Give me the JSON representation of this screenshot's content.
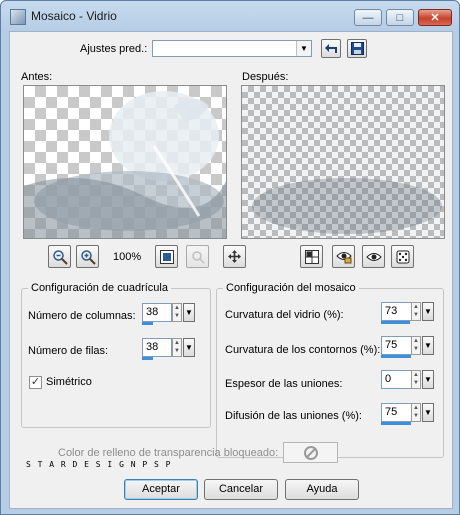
{
  "window": {
    "title": "Mosaico - Vidrio",
    "minimize_glyph": "—",
    "maximize_glyph": "□",
    "close_glyph": "✕"
  },
  "presets": {
    "label": "Ajustes pred.:",
    "value": "",
    "arrow": "▼"
  },
  "previews": {
    "before_label": "Antes:",
    "after_label": "Después:"
  },
  "zoom": {
    "level": "100%"
  },
  "grid_group": {
    "title": "Configuración de cuadrícula",
    "columns_label": "Número de columnas:",
    "columns_value": "38",
    "rows_label": "Número de filas:",
    "rows_value": "38",
    "symmetric_label": "Simétrico",
    "symmetric_check": "✓"
  },
  "mosaic_group": {
    "title": "Configuración del mosaico",
    "glass_curvature_label": "Curvatura del vidrio (%):",
    "glass_curvature_value": "73",
    "edge_curvature_label": "Curvatura de los contornos (%):",
    "edge_curvature_value": "75",
    "joint_thickness_label": "Espesor de las uniones:",
    "joint_thickness_value": "0",
    "joint_diffusion_label": "Difusión de las uniones (%):",
    "joint_diffusion_value": "75"
  },
  "fill": {
    "label": "Color de relleno de transparencia bloqueado:"
  },
  "watermark": "S T A R D E S I G N P S P",
  "buttons": {
    "ok": "Aceptar",
    "cancel": "Cancelar",
    "help": "Ayuda"
  },
  "colors": {
    "accent_bar": "#3c8fde",
    "title_gradient": "#c7daee",
    "close_red": "#c5422c"
  }
}
